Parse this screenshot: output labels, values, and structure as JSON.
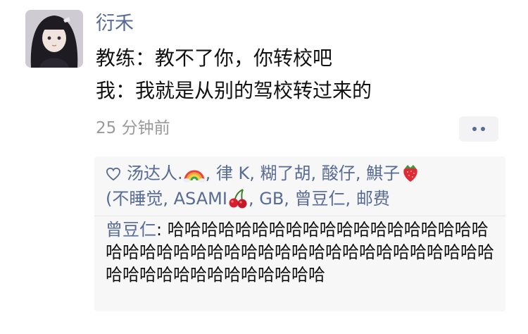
{
  "post": {
    "username": "衍禾",
    "lines": [
      "教练：教不了你，你转校吧",
      "我：我就是从别的驾校转过来的"
    ],
    "time": "25 分钟前"
  },
  "likes": {
    "icon": "heart-outline-icon",
    "names": [
      "汤达人.",
      "律 K",
      "糊了胡",
      "酸仔",
      "鯕子",
      "(不睡觉",
      "ASAMI",
      "GB",
      "曾豆仁",
      "邮费"
    ],
    "emoji": {
      "rainbow": "rainbow-emoji",
      "strawberry": "strawberry-emoji",
      "cherries": "cherries-emoji"
    },
    "separator": ", "
  },
  "comment": {
    "author": "曾豆仁",
    "colon": ": ",
    "text": "哈哈哈哈哈哈哈哈哈哈哈哈哈哈哈哈哈哈哈哈哈哈哈哈哈哈哈哈哈哈哈哈哈哈哈哈哈哈哈哈哈哈哈哈哈哈哈哈哈哈哈哈哈哈哈"
  },
  "colors": {
    "link": "#576b95",
    "text": "#111111",
    "muted": "#9a9a9a",
    "panel": "#f7f7f7"
  }
}
